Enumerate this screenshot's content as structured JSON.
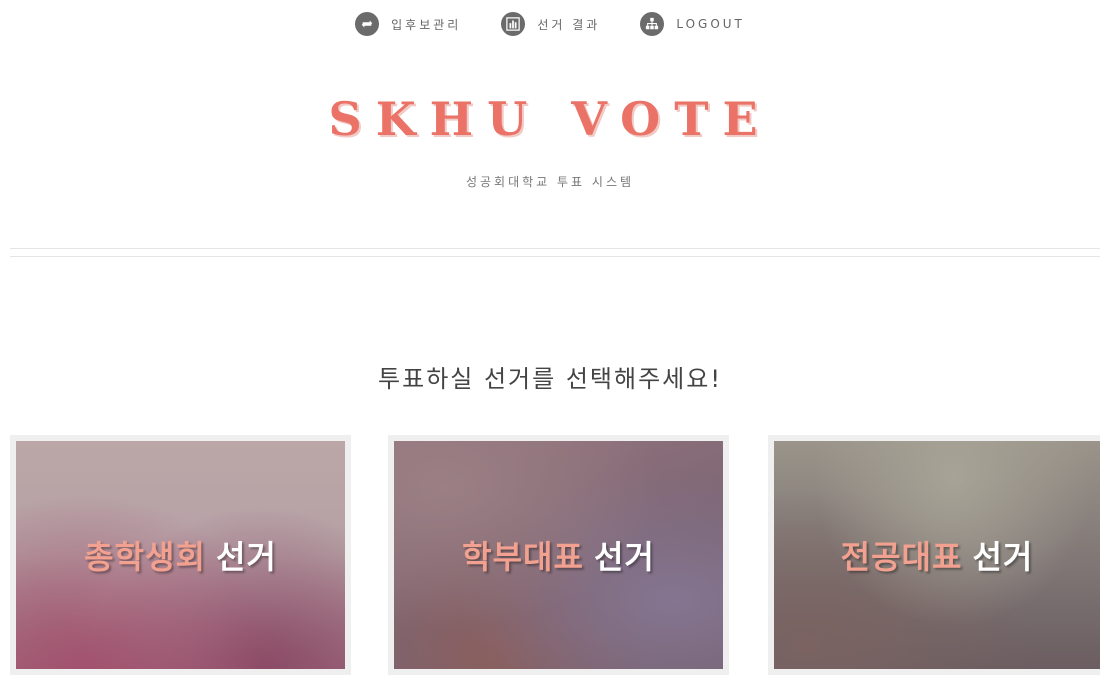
{
  "nav": {
    "items": [
      {
        "label": "입후보관리",
        "icon": "refresh-icon"
      },
      {
        "label": "선거 결과",
        "icon": "bar-chart-icon"
      },
      {
        "label": "LOGOUT",
        "icon": "sitemap-icon"
      }
    ]
  },
  "header": {
    "logo": "SKHU VOTE",
    "subtitle": "성공회대학교 투표 시스템"
  },
  "main": {
    "prompt": "투표하실 선거를 선택해주세요!",
    "cards": [
      {
        "accent": "총학생회",
        "suffix": "선거"
      },
      {
        "accent": "학부대표",
        "suffix": "선거"
      },
      {
        "accent": "전공대표",
        "suffix": "선거"
      }
    ]
  },
  "colors": {
    "brand": "#ea7267",
    "card_accent_text": "#f2a08f",
    "nav_icon_bg": "#6b6b6b"
  }
}
